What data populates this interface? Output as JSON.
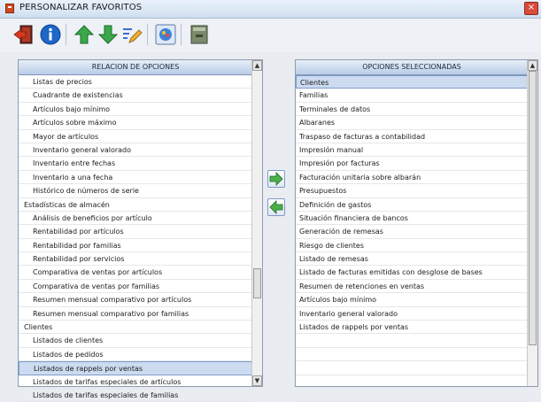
{
  "window": {
    "title": "PERSONALIZAR FAVORITOS",
    "close_glyph": "×"
  },
  "toolbar": {
    "buttons": [
      {
        "icon": "exit-door-icon"
      },
      {
        "icon": "info-icon"
      },
      {
        "icon": "arrow-up-icon"
      },
      {
        "icon": "arrow-down-icon"
      },
      {
        "icon": "edit-pencil-icon"
      },
      {
        "icon": "paint-settings-icon"
      },
      {
        "icon": "archive-icon"
      }
    ]
  },
  "left_panel": {
    "header": "RELACION DE OPCIONES",
    "rows": [
      {
        "text": "Listas de precios",
        "indent": 2
      },
      {
        "text": "Cuadrante de existencias",
        "indent": 2
      },
      {
        "text": "Artículos bajo mínimo",
        "indent": 2
      },
      {
        "text": "Artículos sobre máximo",
        "indent": 2
      },
      {
        "text": "Mayor de artículos",
        "indent": 2
      },
      {
        "text": "Inventario general valorado",
        "indent": 2
      },
      {
        "text": "Inventario entre fechas",
        "indent": 2
      },
      {
        "text": "Inventario a una fecha",
        "indent": 2
      },
      {
        "text": "Histórico de números de serie",
        "indent": 2
      },
      {
        "text": "Estadísticas de almacén",
        "indent": 1
      },
      {
        "text": "Análisis de beneficios por artículo",
        "indent": 2
      },
      {
        "text": "Rentabilidad por artículos",
        "indent": 2
      },
      {
        "text": "Rentabilidad por familias",
        "indent": 2
      },
      {
        "text": "Rentabilidad por servicios",
        "indent": 2
      },
      {
        "text": "Comparativa de ventas por artículos",
        "indent": 2
      },
      {
        "text": "Comparativa de ventas por familias",
        "indent": 2
      },
      {
        "text": "Resumen mensual comparativo por artículos",
        "indent": 2
      },
      {
        "text": "Resumen mensual comparativo por familias",
        "indent": 2
      },
      {
        "text": "Clientes",
        "indent": 1
      },
      {
        "text": "Listados de clientes",
        "indent": 2
      },
      {
        "text": "Listados de pedidos",
        "indent": 2
      },
      {
        "text": "Listados de rappels por ventas",
        "indent": 2,
        "selected": true
      },
      {
        "text": "Listados de tarifas especiales de artículos",
        "indent": 2
      },
      {
        "text": "Listados de tarifas especiales de familias",
        "indent": 2
      }
    ]
  },
  "transfer": {
    "add_icon": "arrow-right-icon",
    "remove_icon": "arrow-left-icon"
  },
  "right_panel": {
    "header": "OPCIONES SELECCIONADAS",
    "rows": [
      {
        "text": "Clientes",
        "selected": true
      },
      {
        "text": "Familias"
      },
      {
        "text": "Terminales de datos"
      },
      {
        "text": "Albaranes"
      },
      {
        "text": "Traspaso de facturas a contabilidad"
      },
      {
        "text": "Impresión manual"
      },
      {
        "text": "Impresión por facturas"
      },
      {
        "text": "Facturación unitaria sobre albarán"
      },
      {
        "text": "Presupuestos"
      },
      {
        "text": "Definición de gastos"
      },
      {
        "text": "Situación financiera de bancos"
      },
      {
        "text": "Generación de remesas"
      },
      {
        "text": "Riesgo de clientes"
      },
      {
        "text": "Listado de remesas"
      },
      {
        "text": "Listado de facturas emitidas con desglose de bases"
      },
      {
        "text": "Resumen de retenciones en ventas"
      },
      {
        "text": "Artículos bajo mínimo"
      },
      {
        "text": "Inventario general valorado"
      },
      {
        "text": "Listados de rappels por ventas"
      },
      {
        "text": ""
      },
      {
        "text": ""
      },
      {
        "text": ""
      },
      {
        "text": ""
      },
      {
        "text": ""
      }
    ]
  },
  "scrollbars": {
    "up_glyph": "▲",
    "down_glyph": "▼",
    "left_thumb_position": 0.72,
    "left_thumb_fraction": 0.1,
    "right_thumb_position": 0,
    "right_thumb_fraction": 0.9
  }
}
